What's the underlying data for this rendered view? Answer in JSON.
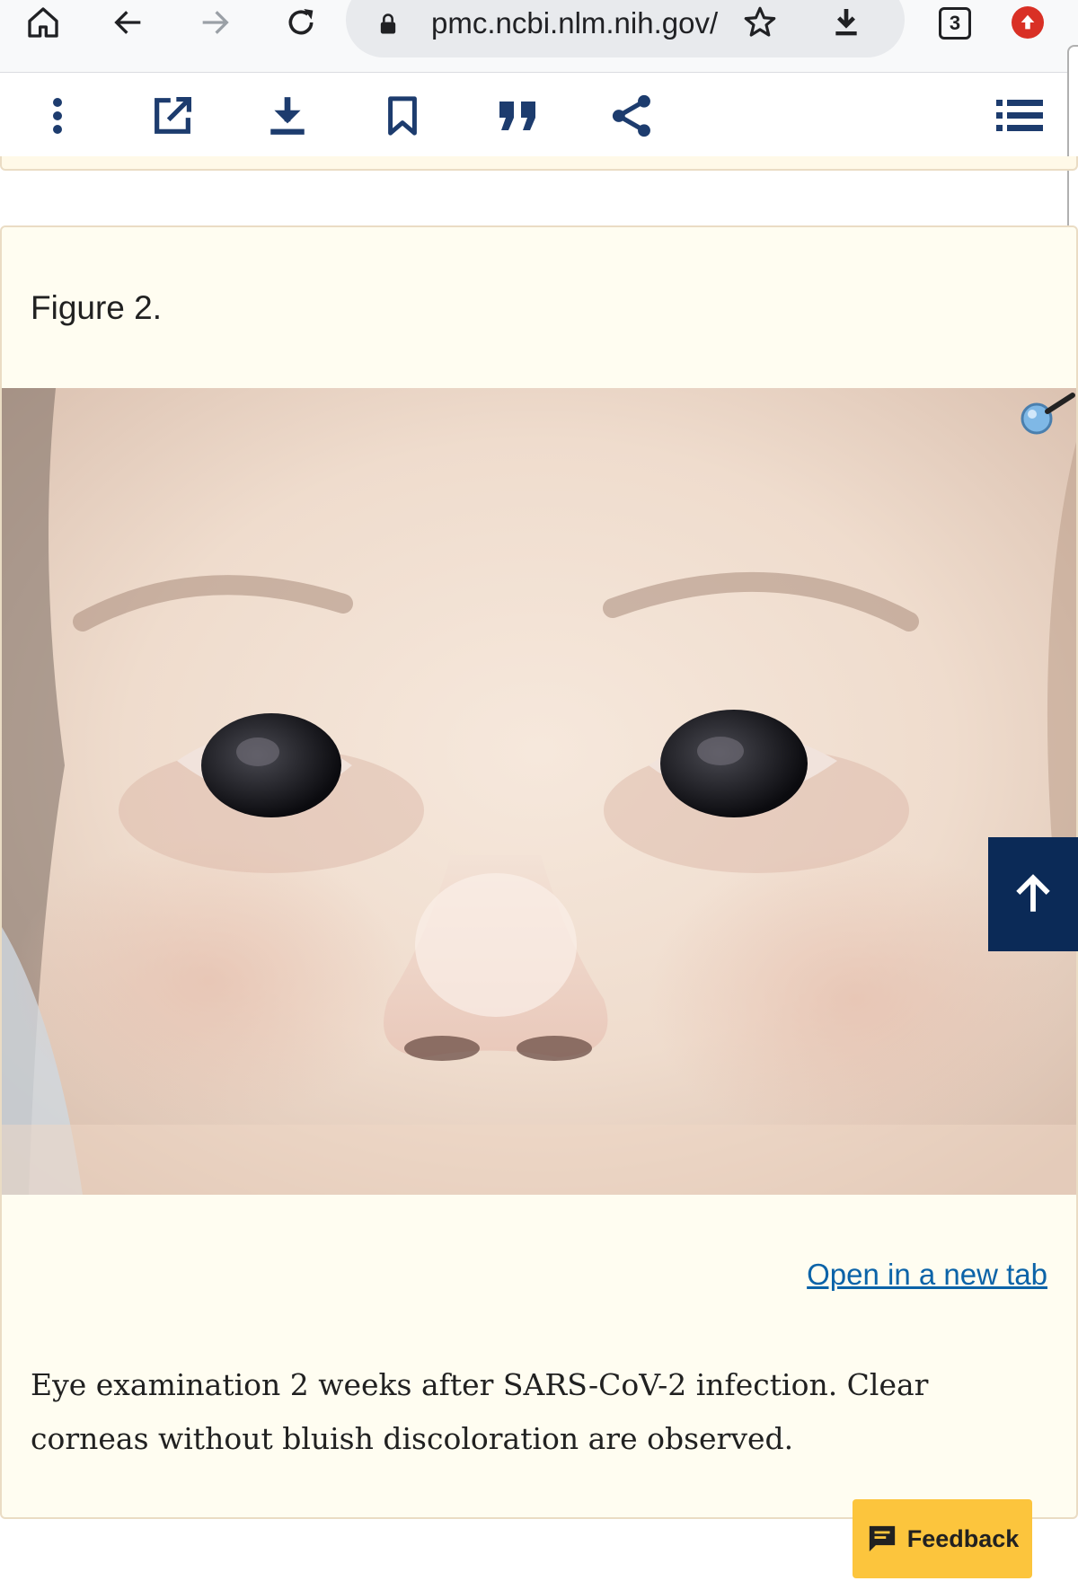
{
  "browser": {
    "url": "pmc.ncbi.nlm.nih.gov/",
    "tab_count": "3",
    "icons": [
      "home-icon",
      "back-arrow-icon",
      "forward-arrow-icon",
      "reload-icon",
      "lock-icon",
      "star-icon",
      "download-icon",
      "tab-switcher-icon",
      "update-icon"
    ]
  },
  "toolbar": {
    "icons": [
      "more-vert-icon",
      "open-external-icon",
      "download-icon",
      "bookmark-icon",
      "cite-quote-icon",
      "share-icon",
      "toc-list-icon"
    ]
  },
  "figure": {
    "label": "Figure 2.",
    "open_link": "Open in a new tab",
    "caption": "Eye examination 2 weeks after SARS-CoV-2 infection. Clear corneas without bluish discoloration are observed."
  },
  "feedback": {
    "label": "Feedback"
  },
  "colors": {
    "accent_navy": "#0b2a57",
    "link_blue": "#0b63a8",
    "toolbar_icon": "#1d3c6e",
    "card_bg": "#fffdf1",
    "feedback_bg": "#fcc53d"
  }
}
